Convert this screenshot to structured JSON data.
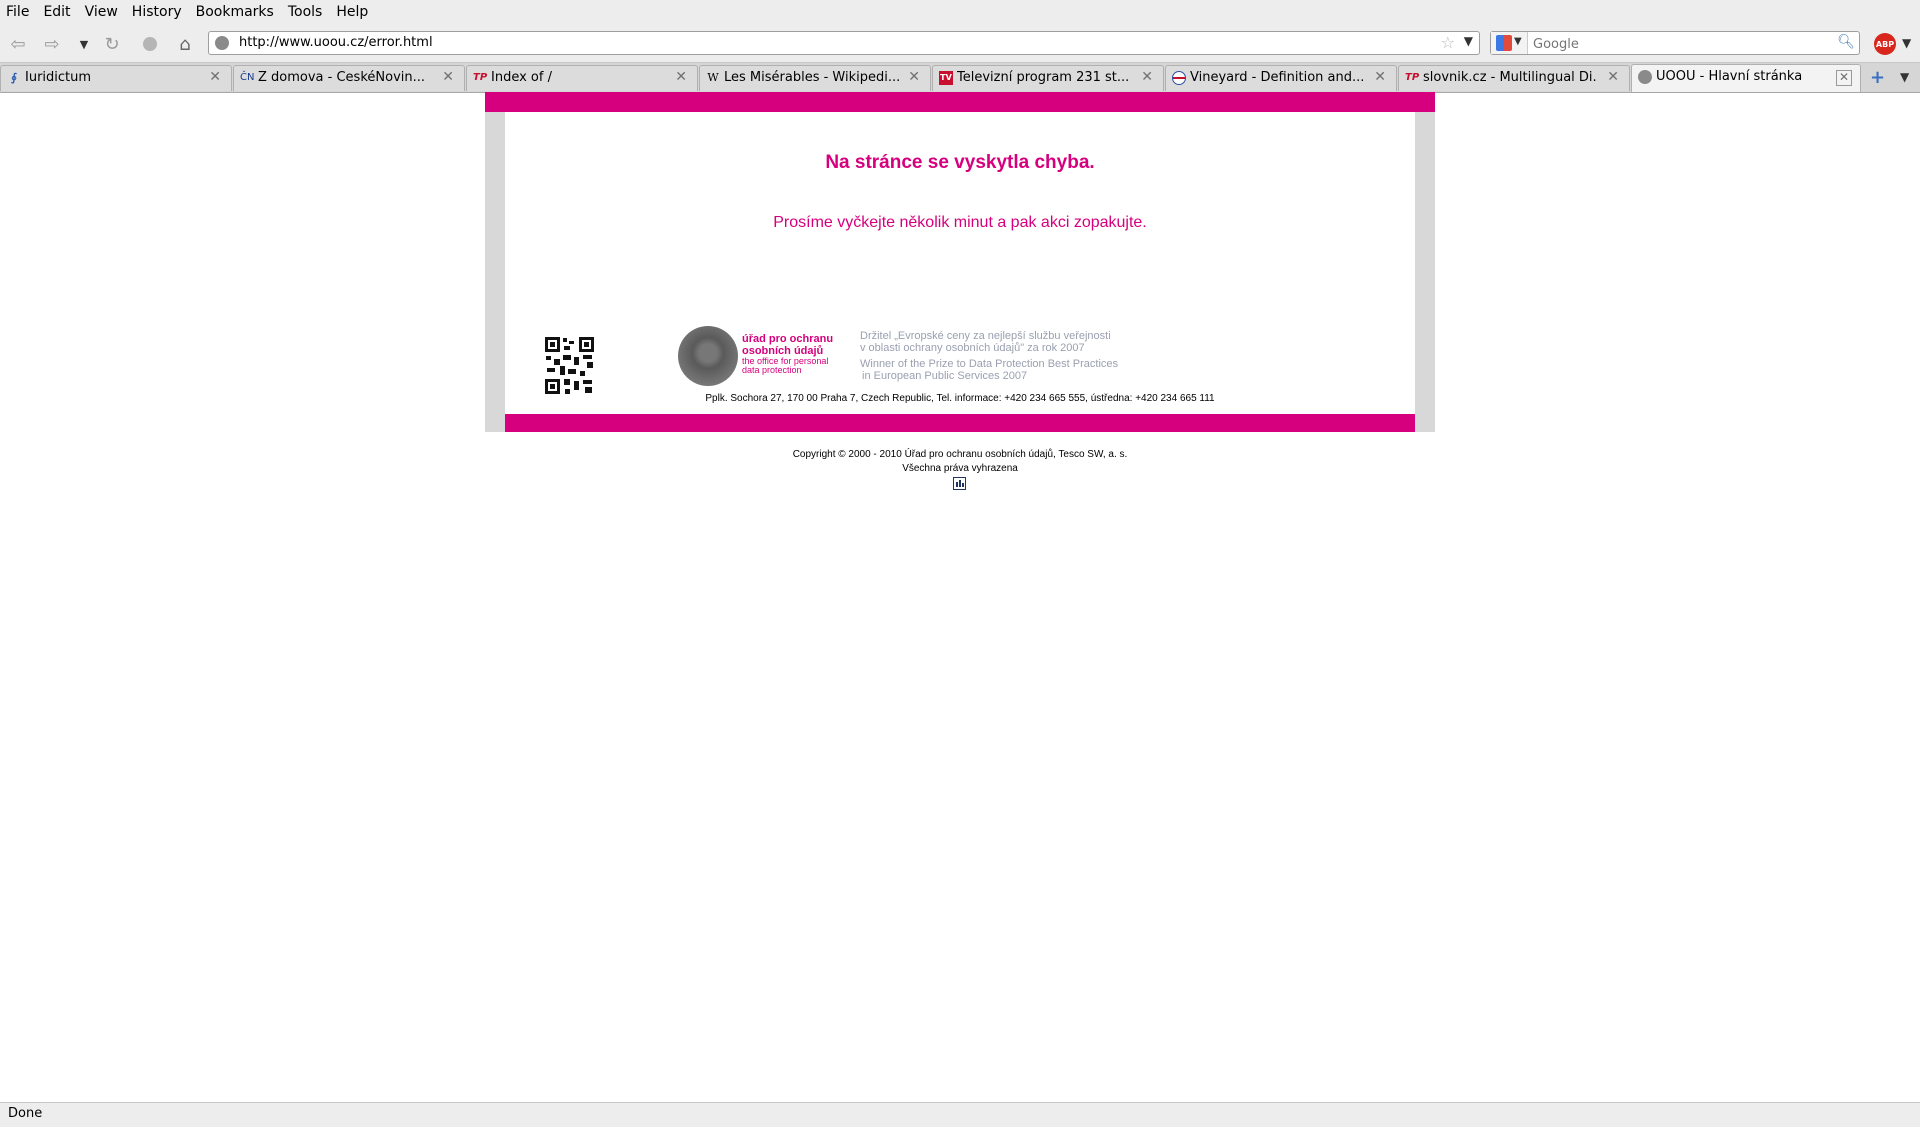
{
  "menu": [
    "File",
    "Edit",
    "View",
    "History",
    "Bookmarks",
    "Tools",
    "Help"
  ],
  "nav": {
    "url": "http://www.uoou.cz/error.html",
    "search_placeholder": "Google"
  },
  "tabs": [
    {
      "title": "Iuridictum",
      "favicon": "iuridictum-icon",
      "active": false
    },
    {
      "title": "Z domova - ČeskéNovin...",
      "favicon": "ceskenoviny-icon",
      "favicon_text": "ČN",
      "active": false
    },
    {
      "title": "Index of /",
      "favicon": "tp-icon",
      "favicon_text": "TP",
      "active": false
    },
    {
      "title": "Les Misérables - Wikipedi...",
      "favicon": "wikipedia-icon",
      "favicon_text": "W",
      "active": false
    },
    {
      "title": "Televizní program 231 st...",
      "favicon": "tv-icon",
      "favicon_text": "TV",
      "active": false
    },
    {
      "title": "Vineyard - Definition and...",
      "favicon": "dictionary-icon",
      "active": false
    },
    {
      "title": "slovnik.cz - Multilingual Di...",
      "favicon": "tp-icon",
      "favicon_text": "TP",
      "active": false
    },
    {
      "title": "ÚOOÚ - Hlavní stránka",
      "favicon": "uoou-icon",
      "active": true
    }
  ],
  "page": {
    "error_title": "Na stránce se vyskytla chyba.",
    "error_message": "Prosíme vyčkejte několik minut a pak akci zopakujte.",
    "logo_cz_line1": "úřad pro ochranu",
    "logo_cz_line2": "osobních údajů",
    "logo_en_line1": "the office for personal",
    "logo_en_line2": "data protection",
    "award_cz_line1": "Držitel „Evropské ceny za nejlepší službu veřejnosti",
    "award_cz_line2": "v oblasti ochrany osobních údajů\" za rok 2007",
    "award_en_line1": "Winner of the Prize to Data Protection Best Practices",
    "award_en_line2": "in European Public Services 2007",
    "address": "Pplk. Sochora 27, 170 00 Praha 7, Czech Republic, Tel. informace: +420 234 665 555, ústředna: +420 234 665 111",
    "copyright_line1": "Copyright © 2000 - 2010 Úřad pro ochranu osobních údajů, Tesco SW, a. s.",
    "copyright_line2": "Všechna práva vyhrazena"
  },
  "colors": {
    "brand": "#d6007e",
    "frame": "#d8d8d8",
    "award_text": "#9aa0b0"
  },
  "status": "Done"
}
